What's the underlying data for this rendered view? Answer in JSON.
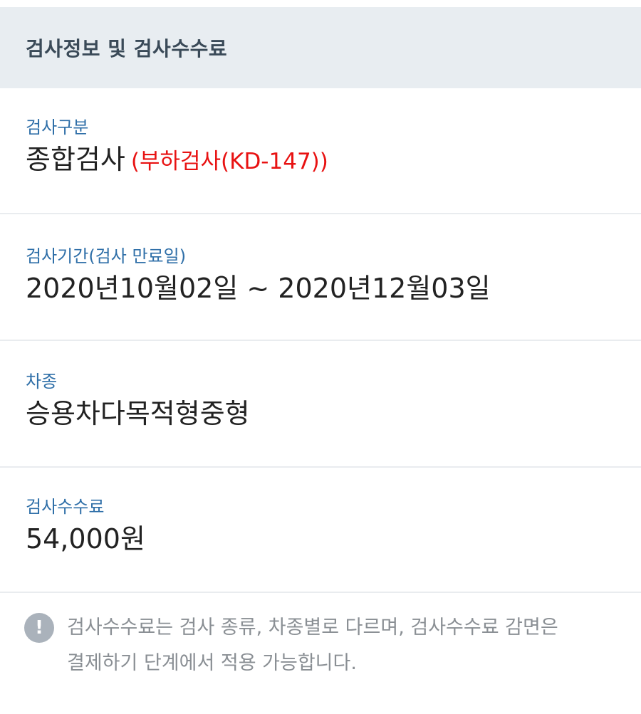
{
  "header": {
    "title": "검사정보 및 검사수수료"
  },
  "inspection_type": {
    "label": "검사구분",
    "value": "종합검사",
    "detail": "(부하검사(KD-147))"
  },
  "inspection_period": {
    "label": "검사기간(검사 만료일)",
    "value": "2020년10월02일 ~ 2020년12월03일"
  },
  "vehicle_type": {
    "label": "차종",
    "value": "승용차다목적형중형"
  },
  "inspection_fee": {
    "label": "검사수수료",
    "value": "54,000원"
  },
  "notice": {
    "icon": "exclamation-icon",
    "icon_glyph": "!",
    "text": "검사수수료는 검사 종류, 차종별로 다르며, 검사수수료 감면은 결제하기 단계에서 적용 가능합니다."
  },
  "colors": {
    "header_bg": "#e8edf1",
    "label": "#2f6fa8",
    "highlight": "#e81212",
    "notice_text": "#8a8f94"
  }
}
